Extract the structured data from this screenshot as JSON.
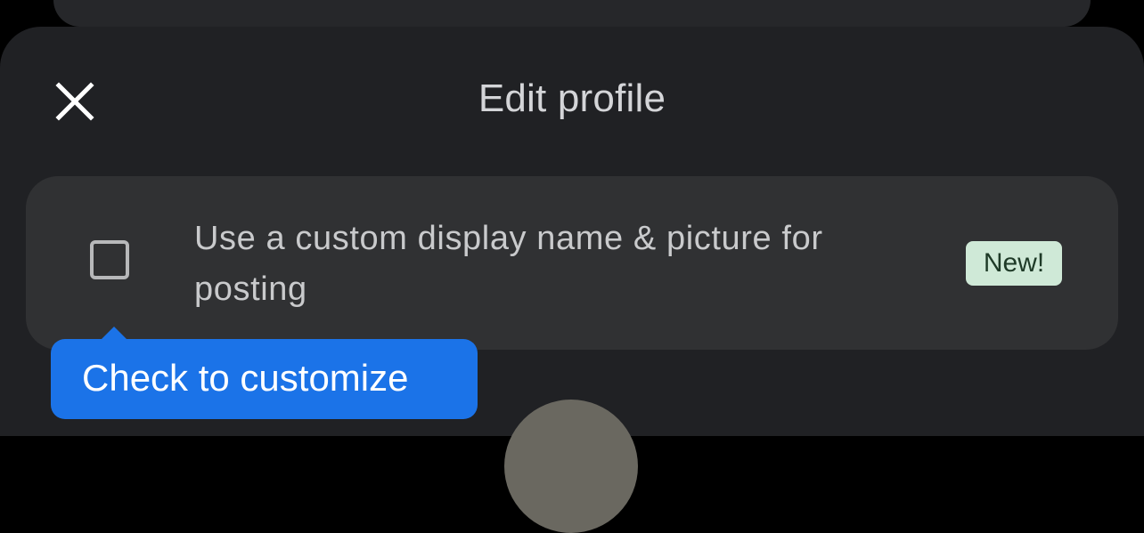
{
  "header": {
    "title": "Edit profile",
    "close_icon": "close-icon"
  },
  "option": {
    "label": "Use a custom display name & picture for posting",
    "checked": false,
    "badge": "New!"
  },
  "tooltip": {
    "text": "Check to customize"
  },
  "colors": {
    "sheet_background": "#202124",
    "card_background": "#303133",
    "badge_background": "#cfe9d7",
    "tooltip_background": "#1b73e8"
  }
}
